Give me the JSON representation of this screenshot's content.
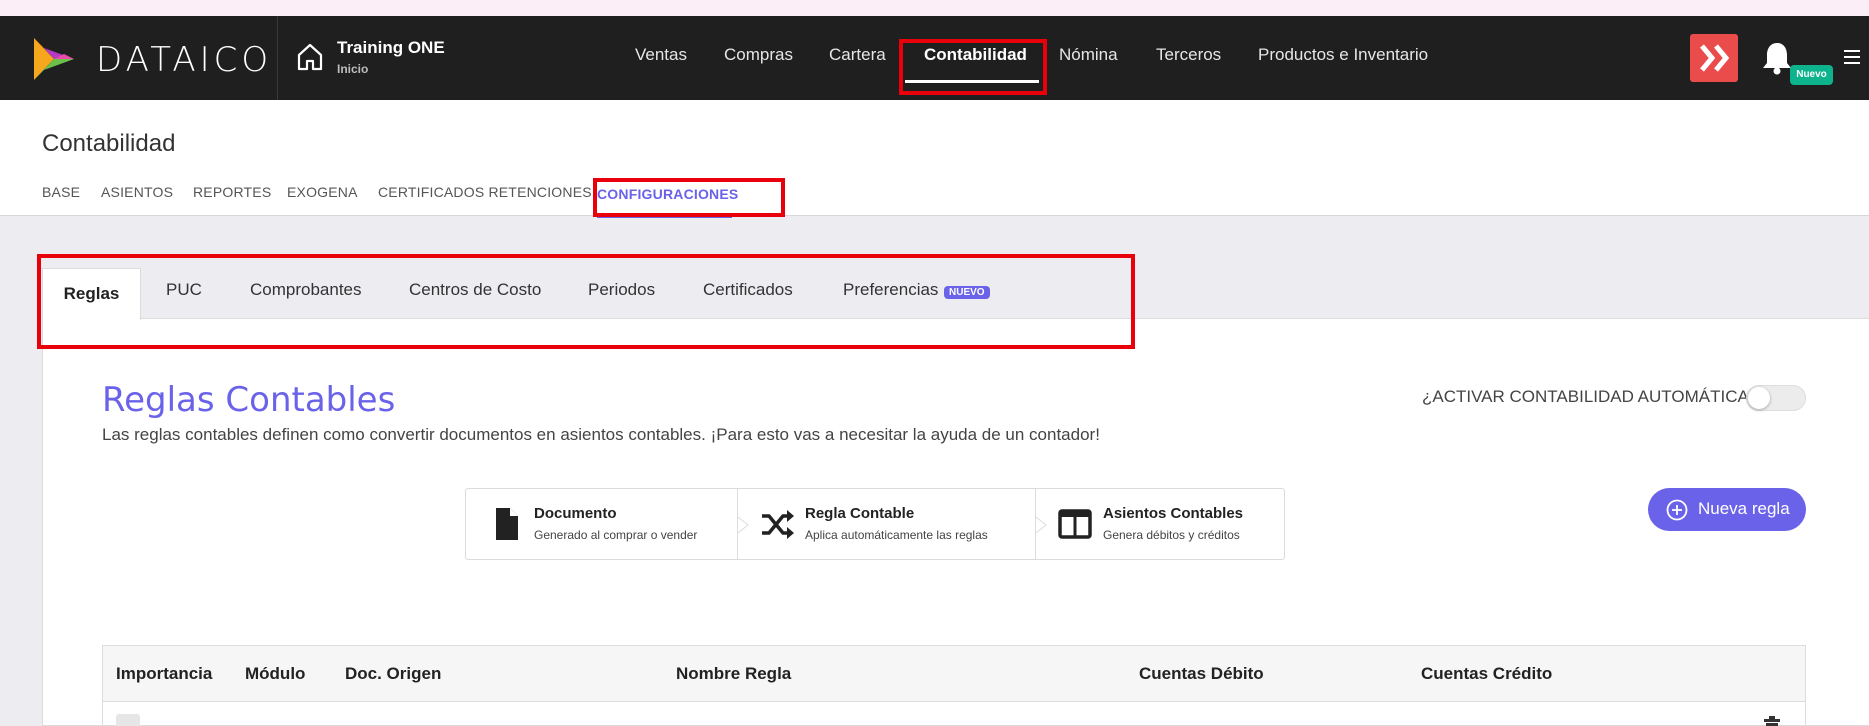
{
  "brand": {
    "name": "DATAICO"
  },
  "company": {
    "name": "Training ONE",
    "sub": "Inicio"
  },
  "nav": {
    "items": [
      "Ventas",
      "Compras",
      "Cartera",
      "Contabilidad",
      "Nómina",
      "Terceros",
      "Productos e Inventario"
    ],
    "active": "Contabilidad"
  },
  "notifications": {
    "badge": "Nuevo"
  },
  "page": {
    "title": "Contabilidad"
  },
  "subnav": {
    "items": [
      "BASE",
      "ASIENTOS",
      "REPORTES",
      "EXOGENA",
      "CERTIFICADOS RETENCIONES",
      "CONFIGURACIONES"
    ],
    "active": "CONFIGURACIONES"
  },
  "tabs": {
    "items": [
      "Reglas",
      "PUC",
      "Comprobantes",
      "Centros de Costo",
      "Periodos",
      "Certificados",
      "Preferencias"
    ],
    "active": "Reglas",
    "new_tag": "NUEVO"
  },
  "rules": {
    "title": "Reglas Contables",
    "description": "Las reglas contables definen como convertir documentos en asientos contables. ¡Para esto vas a necesitar la ayuda de un contador!",
    "auto_label": "¿ACTIVAR CONTABILIDAD AUTOMÁTICA?",
    "auto_enabled": false,
    "new_button": "Nueva regla"
  },
  "flow": [
    {
      "title": "Documento",
      "sub": "Generado al comprar o vender",
      "icon": "document-icon"
    },
    {
      "title": "Regla Contable",
      "sub": "Aplica automáticamente las reglas",
      "icon": "shuffle-icon"
    },
    {
      "title": "Asientos Contables",
      "sub": "Genera débitos y créditos",
      "icon": "columns-icon"
    }
  ],
  "table": {
    "headers": [
      "Importancia",
      "Módulo",
      "Doc. Origen",
      "Nombre Regla",
      "Cuentas Débito",
      "Cuentas Crédito"
    ]
  },
  "colors": {
    "accent": "#6a62e8",
    "nav_bg": "#1f1f1f",
    "highlight": "#e8000b",
    "badge": "#0db38c"
  }
}
